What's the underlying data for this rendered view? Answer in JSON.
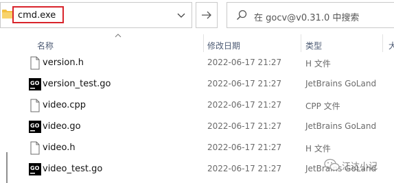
{
  "address_bar": {
    "path_text": "cmd.exe"
  },
  "search": {
    "placeholder": "在 gocv@v0.31.0 中搜索"
  },
  "columns": {
    "name": "名称",
    "modified": "修改日期",
    "type": "类型",
    "size_partial": "大"
  },
  "files": [
    {
      "name": "version.h",
      "modified": "2022-06-17 21:27",
      "type": "H 文件",
      "icon": "document-icon"
    },
    {
      "name": "version_test.go",
      "modified": "2022-06-17 21:27",
      "type": "JetBrains GoLand",
      "icon": "goland-icon"
    },
    {
      "name": "video.cpp",
      "modified": "2022-06-17 21:27",
      "type": "CPP 文件",
      "icon": "document-icon"
    },
    {
      "name": "video.go",
      "modified": "2022-06-17 21:27",
      "type": "JetBrains GoLand",
      "icon": "goland-icon"
    },
    {
      "name": "video.h",
      "modified": "2022-06-17 21:27",
      "type": "H 文件",
      "icon": "document-icon"
    },
    {
      "name": "video_test.go",
      "modified": "2022-06-17 21:27",
      "type": "JetBrains GoLand",
      "icon": "goland-icon"
    }
  ],
  "goland_icon_text": "GO",
  "watermark": {
    "text": "江达小记"
  },
  "colors": {
    "highlight": "#d8232a",
    "folder": "#f3c042",
    "goland_bg": "#000000"
  }
}
